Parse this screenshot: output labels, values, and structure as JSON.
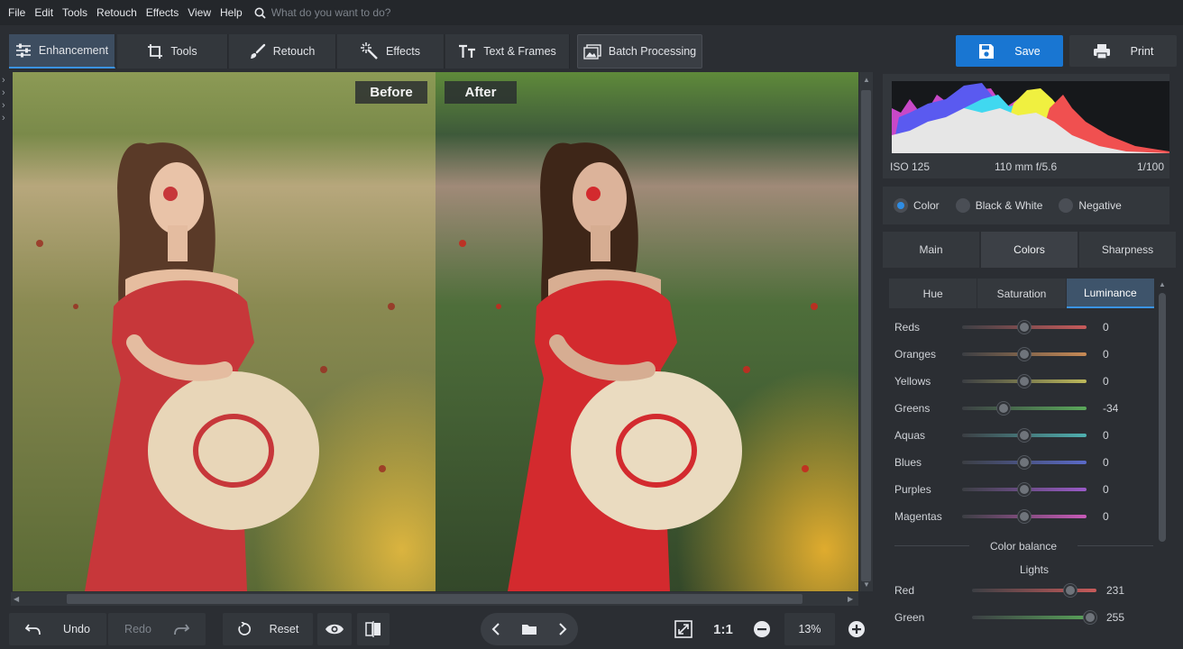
{
  "menu": {
    "items": [
      "File",
      "Edit",
      "Tools",
      "Retouch",
      "Effects",
      "View",
      "Help"
    ],
    "search_placeholder": "What do you want to do?",
    "search_icon": "search-icon"
  },
  "toolbar": {
    "tabs": [
      {
        "label": "Enhancement",
        "icon": "sliders-icon",
        "active": true
      },
      {
        "label": "Tools",
        "icon": "crop-icon"
      },
      {
        "label": "Retouch",
        "icon": "brush-icon"
      },
      {
        "label": "Effects",
        "icon": "magic-wand-icon"
      },
      {
        "label": "Text & Frames",
        "icon": "text-icon"
      },
      {
        "label": "Batch Processing",
        "icon": "images-icon"
      }
    ],
    "save_label": "Save",
    "print_label": "Print"
  },
  "canvas": {
    "before_label": "Before",
    "after_label": "After"
  },
  "bottombar": {
    "undo_label": "Undo",
    "redo_label": "Redo",
    "reset_label": "Reset",
    "ratio_label": "1:1",
    "zoom_value": "13%"
  },
  "histogram": {
    "iso": "ISO 125",
    "lens": "110 mm f/5.6",
    "shutter": "1/100"
  },
  "mode": {
    "options": [
      "Color",
      "Black & White",
      "Negative"
    ],
    "selected": "Color"
  },
  "panel_tabs": [
    "Main",
    "Colors",
    "Sharpness"
  ],
  "panel_tab_active": "Colors",
  "sub_tabs": [
    "Hue",
    "Saturation",
    "Luminance"
  ],
  "sub_tab_active": "Luminance",
  "luminance": [
    {
      "name": "Reds",
      "value": "0",
      "level": 0.5,
      "color": "#c85a5a"
    },
    {
      "name": "Oranges",
      "value": "0",
      "level": 0.5,
      "color": "#c88a55"
    },
    {
      "name": "Yellows",
      "value": "0",
      "level": 0.5,
      "color": "#bcb85a"
    },
    {
      "name": "Greens",
      "value": "-34",
      "level": 0.33,
      "color": "#5aa85a"
    },
    {
      "name": "Aquas",
      "value": "0",
      "level": 0.5,
      "color": "#4fb0b0"
    },
    {
      "name": "Blues",
      "value": "0",
      "level": 0.5,
      "color": "#5a6ac8"
    },
    {
      "name": "Purples",
      "value": "0",
      "level": 0.5,
      "color": "#9a5ac8"
    },
    {
      "name": "Magentas",
      "value": "0",
      "level": 0.5,
      "color": "#c85ab8"
    }
  ],
  "color_balance": {
    "title": "Color balance",
    "lights_label": "Lights",
    "rows": [
      {
        "name": "Red",
        "value": "231",
        "level": 0.79,
        "color": "#c85a5a"
      },
      {
        "name": "Green",
        "value": "255",
        "level": 0.95,
        "color": "#5aa85a"
      }
    ]
  }
}
